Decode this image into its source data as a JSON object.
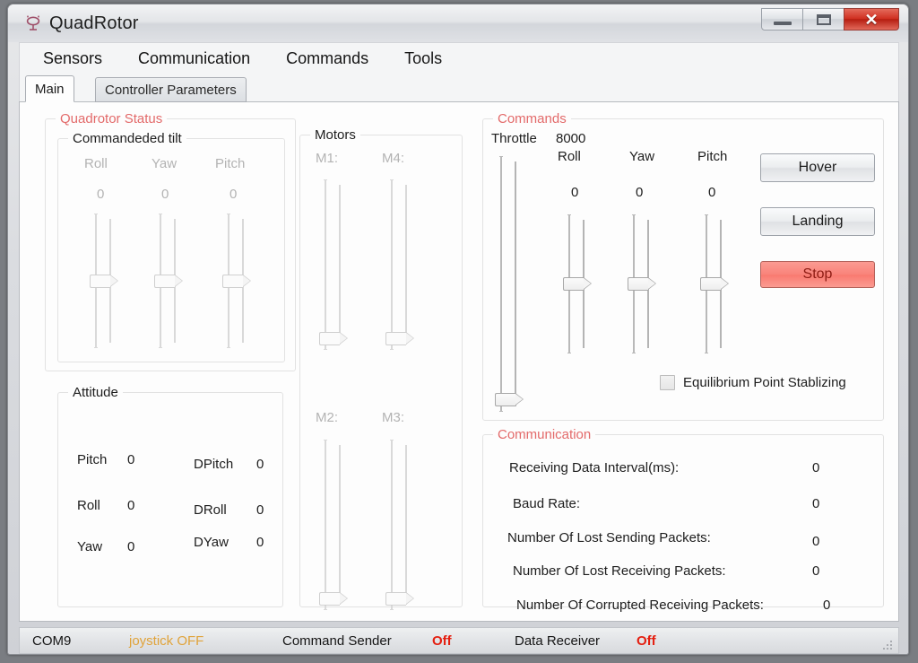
{
  "window": {
    "title": "QuadRotor",
    "icon": "quadrotor-icon",
    "ghost_text": "",
    "controls": {
      "minimize": "minimize-button",
      "maximize": "maximize-button",
      "close_glyph": "✕"
    }
  },
  "menu": {
    "items": [
      {
        "label": "Sensors"
      },
      {
        "label": "Communication"
      },
      {
        "label": "Commands"
      },
      {
        "label": "Tools"
      }
    ]
  },
  "tabs": [
    {
      "label": "Main",
      "active": true
    },
    {
      "label": "Controller Parameters",
      "active": false
    }
  ],
  "quadrotor_status": {
    "title": "Quadrotor Status",
    "commanded_tilt": {
      "title": "Commandeded tilt",
      "channels": [
        {
          "label": "Roll",
          "value": "0"
        },
        {
          "label": "Yaw",
          "value": "0"
        },
        {
          "label": "Pitch",
          "value": "0"
        }
      ]
    },
    "attitude": {
      "title": "Attitude",
      "rows": [
        {
          "name": "Pitch",
          "value": "0",
          "dname": "DPitch",
          "dvalue": "0"
        },
        {
          "name": "Roll",
          "value": "0",
          "dname": "DRoll",
          "dvalue": "0"
        },
        {
          "name": "Yaw",
          "value": "0",
          "dname": "DYaw",
          "dvalue": "0"
        }
      ]
    }
  },
  "motors": {
    "title": "Motors",
    "channels": [
      {
        "label": "M1:"
      },
      {
        "label": "M4:"
      },
      {
        "label": "M2:"
      },
      {
        "label": "M3:"
      }
    ]
  },
  "commands": {
    "title": "Commands",
    "throttle": {
      "label": "Throttle",
      "value": "8000"
    },
    "axes": [
      {
        "label": "Roll",
        "value": "0"
      },
      {
        "label": "Yaw",
        "value": "0"
      },
      {
        "label": "Pitch",
        "value": "0"
      }
    ],
    "buttons": [
      {
        "label": "Hover",
        "style": "normal"
      },
      {
        "label": "Landing",
        "style": "normal"
      },
      {
        "label": "Stop",
        "style": "danger"
      }
    ],
    "checkbox": {
      "label": "Equilibrium Point Stablizing",
      "checked": false
    }
  },
  "communication": {
    "title": "Communication",
    "rows": [
      {
        "label": "Receiving Data Interval(ms):",
        "value": "0"
      },
      {
        "label": "Baud Rate:",
        "value": "0"
      },
      {
        "label": "Number Of Lost Sending Packets:",
        "value": "0"
      },
      {
        "label": "Number Of Lost Receiving Packets:",
        "value": "0"
      },
      {
        "label": "Number Of Corrupted Receiving Packets:",
        "value": "0"
      }
    ]
  },
  "statusbar": {
    "port": "COM9",
    "joystick": "joystick OFF",
    "command_sender_label": "Command Sender",
    "command_sender_state": "Off",
    "data_receiver_label": "Data Receiver",
    "data_receiver_state": "Off"
  },
  "colors": {
    "group_title_red": "#e36a6a",
    "status_red": "#e41e0f",
    "joystick_amber": "#e0a33a",
    "stop_fill": "#f9837a",
    "stop_text": "#8d1c13",
    "close_button": "#cf2f20"
  }
}
